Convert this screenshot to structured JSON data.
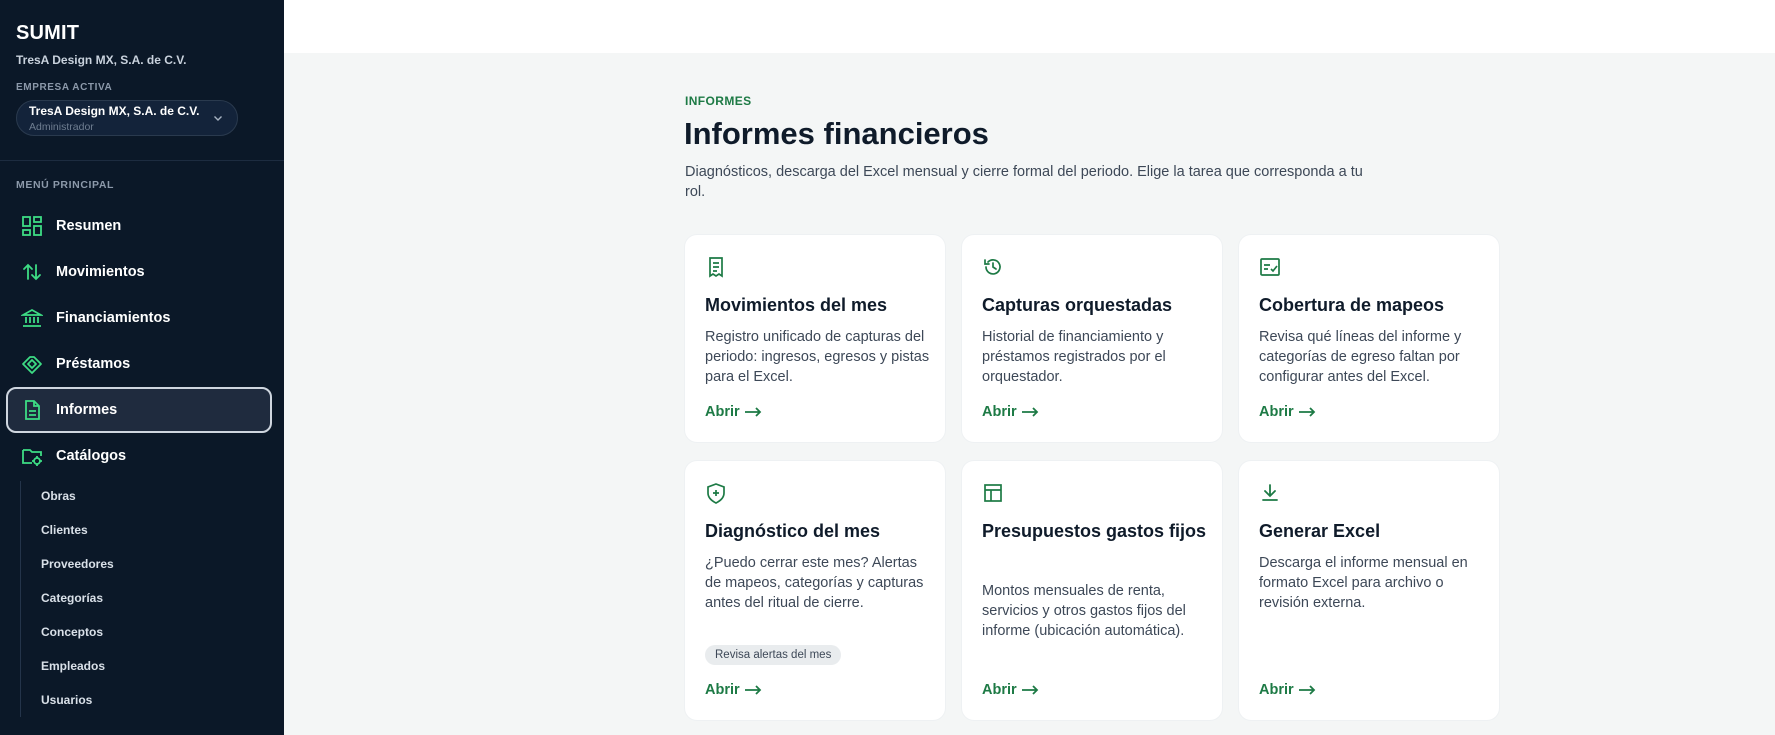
{
  "sidebar": {
    "brand": "SUMIT",
    "company_name": "TresA Design MX, S.A. de C.V.",
    "company_label": "EMPRESA ACTIVA",
    "selector": {
      "name": "TresA Design MX, S.A. de C.V.",
      "role": "Administrador"
    },
    "menu_label": "MENÚ PRINCIPAL",
    "items": [
      {
        "label": "Resumen",
        "icon": "dashboard-icon"
      },
      {
        "label": "Movimientos",
        "icon": "arrows-updown-icon"
      },
      {
        "label": "Financiamientos",
        "icon": "bank-icon"
      },
      {
        "label": "Préstamos",
        "icon": "handshake-icon"
      },
      {
        "label": "Informes",
        "icon": "document-icon",
        "active": true
      },
      {
        "label": "Catálogos",
        "icon": "folder-gear-icon"
      }
    ],
    "subitems": [
      "Obras",
      "Clientes",
      "Proveedores",
      "Categorías",
      "Conceptos",
      "Empleados",
      "Usuarios"
    ]
  },
  "header": {
    "eyebrow": "INFORMES",
    "title": "Informes financieros",
    "description": "Diagnósticos, descarga del Excel mensual y cierre formal del periodo. Elige la tarea que corresponda a tu rol."
  },
  "cards": [
    {
      "title": "Movimientos del mes",
      "description": "Registro unificado de capturas del periodo: ingresos, egresos y pistas para el Excel.",
      "link": "Abrir",
      "icon": "receipt-icon"
    },
    {
      "title": "Capturas orquestadas",
      "description": "Historial de financiamiento y préstamos registrados por el orquestador.",
      "link": "Abrir",
      "icon": "history-icon"
    },
    {
      "title": "Cobertura de mapeos",
      "description": "Revisa qué líneas del informe y categorías de egreso faltan por configurar antes del Excel.",
      "link": "Abrir",
      "icon": "checklist-icon"
    },
    {
      "title": "Diagnóstico del mes",
      "description": "¿Puedo cerrar este mes? Alertas de mapeos, categorías y capturas antes del ritual de cierre.",
      "badge": "Revisa alertas del mes",
      "link": "Abrir",
      "icon": "shield-plus-icon"
    },
    {
      "title": "Presupuestos gastos fijos",
      "description": "Montos mensuales de renta, servicios y otros gastos fijos del informe (ubicación automática).",
      "link": "Abrir",
      "icon": "table-icon"
    },
    {
      "title": "Generar Excel",
      "description": "Descarga el informe mensual en formato Excel para archivo o revisión externa.",
      "link": "Abrir",
      "icon": "download-icon"
    }
  ],
  "colors": {
    "sidebar": "#0b1828",
    "accent": "#1d7a45",
    "icon_green": "#3ddc84"
  }
}
